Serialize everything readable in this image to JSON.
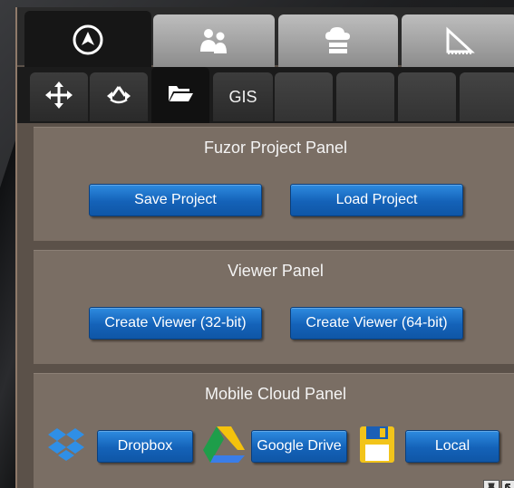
{
  "top_tabs": [
    {
      "icon": "navigation-compass-icon",
      "active": true
    },
    {
      "icon": "people-icon",
      "active": false
    },
    {
      "icon": "cloud-server-icon",
      "active": false
    },
    {
      "icon": "ruler-triangle-icon",
      "active": false
    }
  ],
  "sub_tabs": [
    {
      "icon": "move-arrows-icon"
    },
    {
      "icon": "rotate-icon"
    },
    {
      "icon": "folder-open-icon",
      "active": true
    },
    {
      "label": "GIS"
    }
  ],
  "project_panel": {
    "title": "Fuzor Project Panel",
    "save_label": "Save Project",
    "load_label": "Load Project"
  },
  "viewer_panel": {
    "title": "Viewer Panel",
    "viewer32_label": "Create Viewer (32-bit)",
    "viewer64_label": "Create Viewer (64-bit)"
  },
  "cloud_panel": {
    "title": "Mobile Cloud Panel",
    "dropbox_label": "Dropbox",
    "gdrive_label": "Google Drive",
    "local_label": "Local"
  },
  "colors": {
    "button_blue": "#1462b8",
    "panel_bg": "#7a6e64",
    "separator": "#5b5149"
  }
}
